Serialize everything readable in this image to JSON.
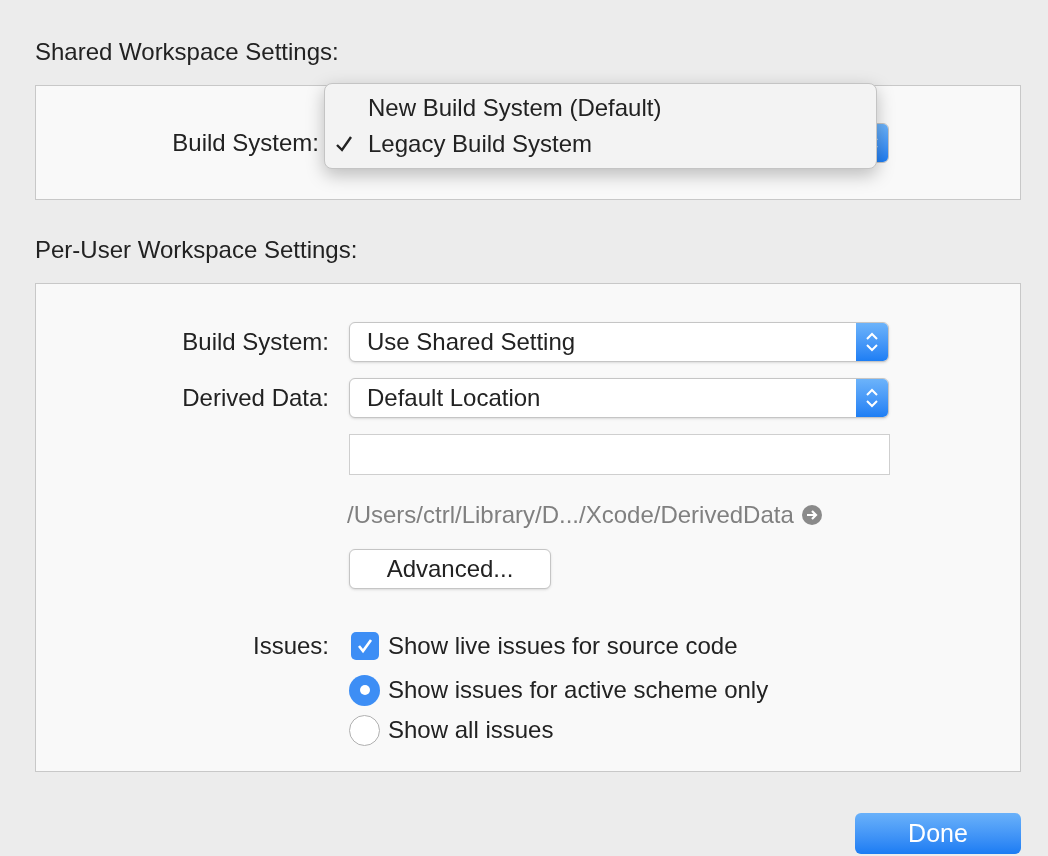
{
  "shared": {
    "title": "Shared Workspace Settings:",
    "build_system_label": "Build System:",
    "menu": [
      {
        "label": "New Build System (Default)",
        "selected": false
      },
      {
        "label": "Legacy Build System",
        "selected": true
      }
    ]
  },
  "per_user": {
    "title": "Per-User Workspace Settings:",
    "fields": [
      {
        "label": "Build System:",
        "value": "Use Shared Setting"
      },
      {
        "label": "Derived Data:",
        "value": "Default Location"
      }
    ],
    "path": "/Users/ctrl/Library/D.../Xcode/DerivedData",
    "advanced": "Advanced...",
    "issues_label": "Issues:",
    "live_issues": {
      "label": "Show live issues for source code",
      "checked": true
    },
    "scope": [
      {
        "label": "Show issues for active scheme only",
        "selected": true
      },
      {
        "label": "Show all issues",
        "selected": false
      }
    ]
  },
  "done": "Done"
}
